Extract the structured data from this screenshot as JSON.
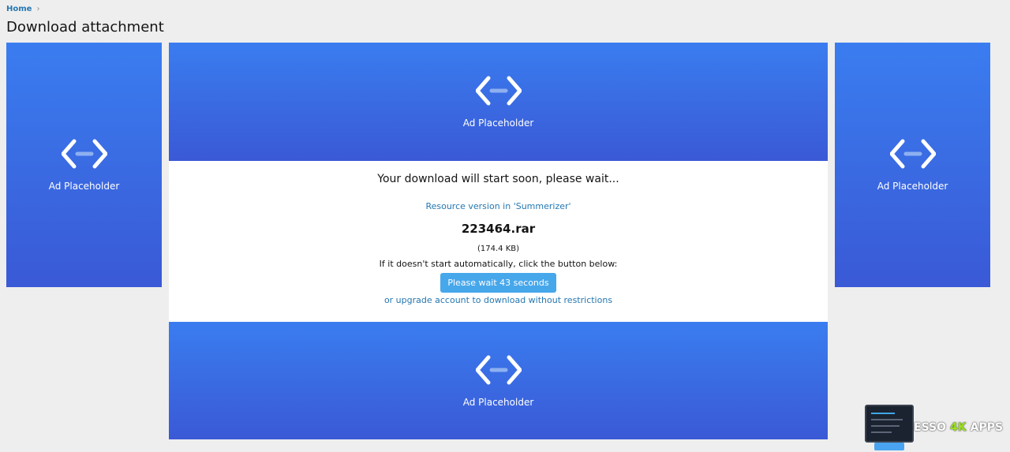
{
  "breadcrumb": {
    "home": "Home",
    "separator": "›"
  },
  "page": {
    "title": "Download attachment"
  },
  "ads": {
    "left": {
      "label": "Ad Placeholder",
      "icon": "code-icon"
    },
    "top": {
      "label": "Ad Placeholder",
      "icon": "code-icon"
    },
    "right": {
      "label": "Ad Placeholder",
      "icon": "code-icon"
    },
    "bottom": {
      "label": "Ad Placeholder",
      "icon": "code-icon"
    }
  },
  "download": {
    "headline": "Your download will start soon, please wait...",
    "resource_link": "Resource version in 'Summerizer'",
    "filename": "223464.rar",
    "filesize": "(174.4 KB)",
    "hint": "If it doesn't start automatically, click the button below:",
    "wait_button": "Please wait 43 seconds",
    "upgrade_link": "or upgrade account to download without restrictions"
  },
  "watermark": {
    "part1": "ESSO",
    "part2": "4K",
    "part3": "APPS"
  },
  "colors": {
    "background": "#eeeeee",
    "link": "#2577b1",
    "ad_gradient_top": "#3a7df0",
    "ad_gradient_bottom": "#3a59d6",
    "button": "#47a7eb",
    "watermark_accent": "#9be21b"
  }
}
